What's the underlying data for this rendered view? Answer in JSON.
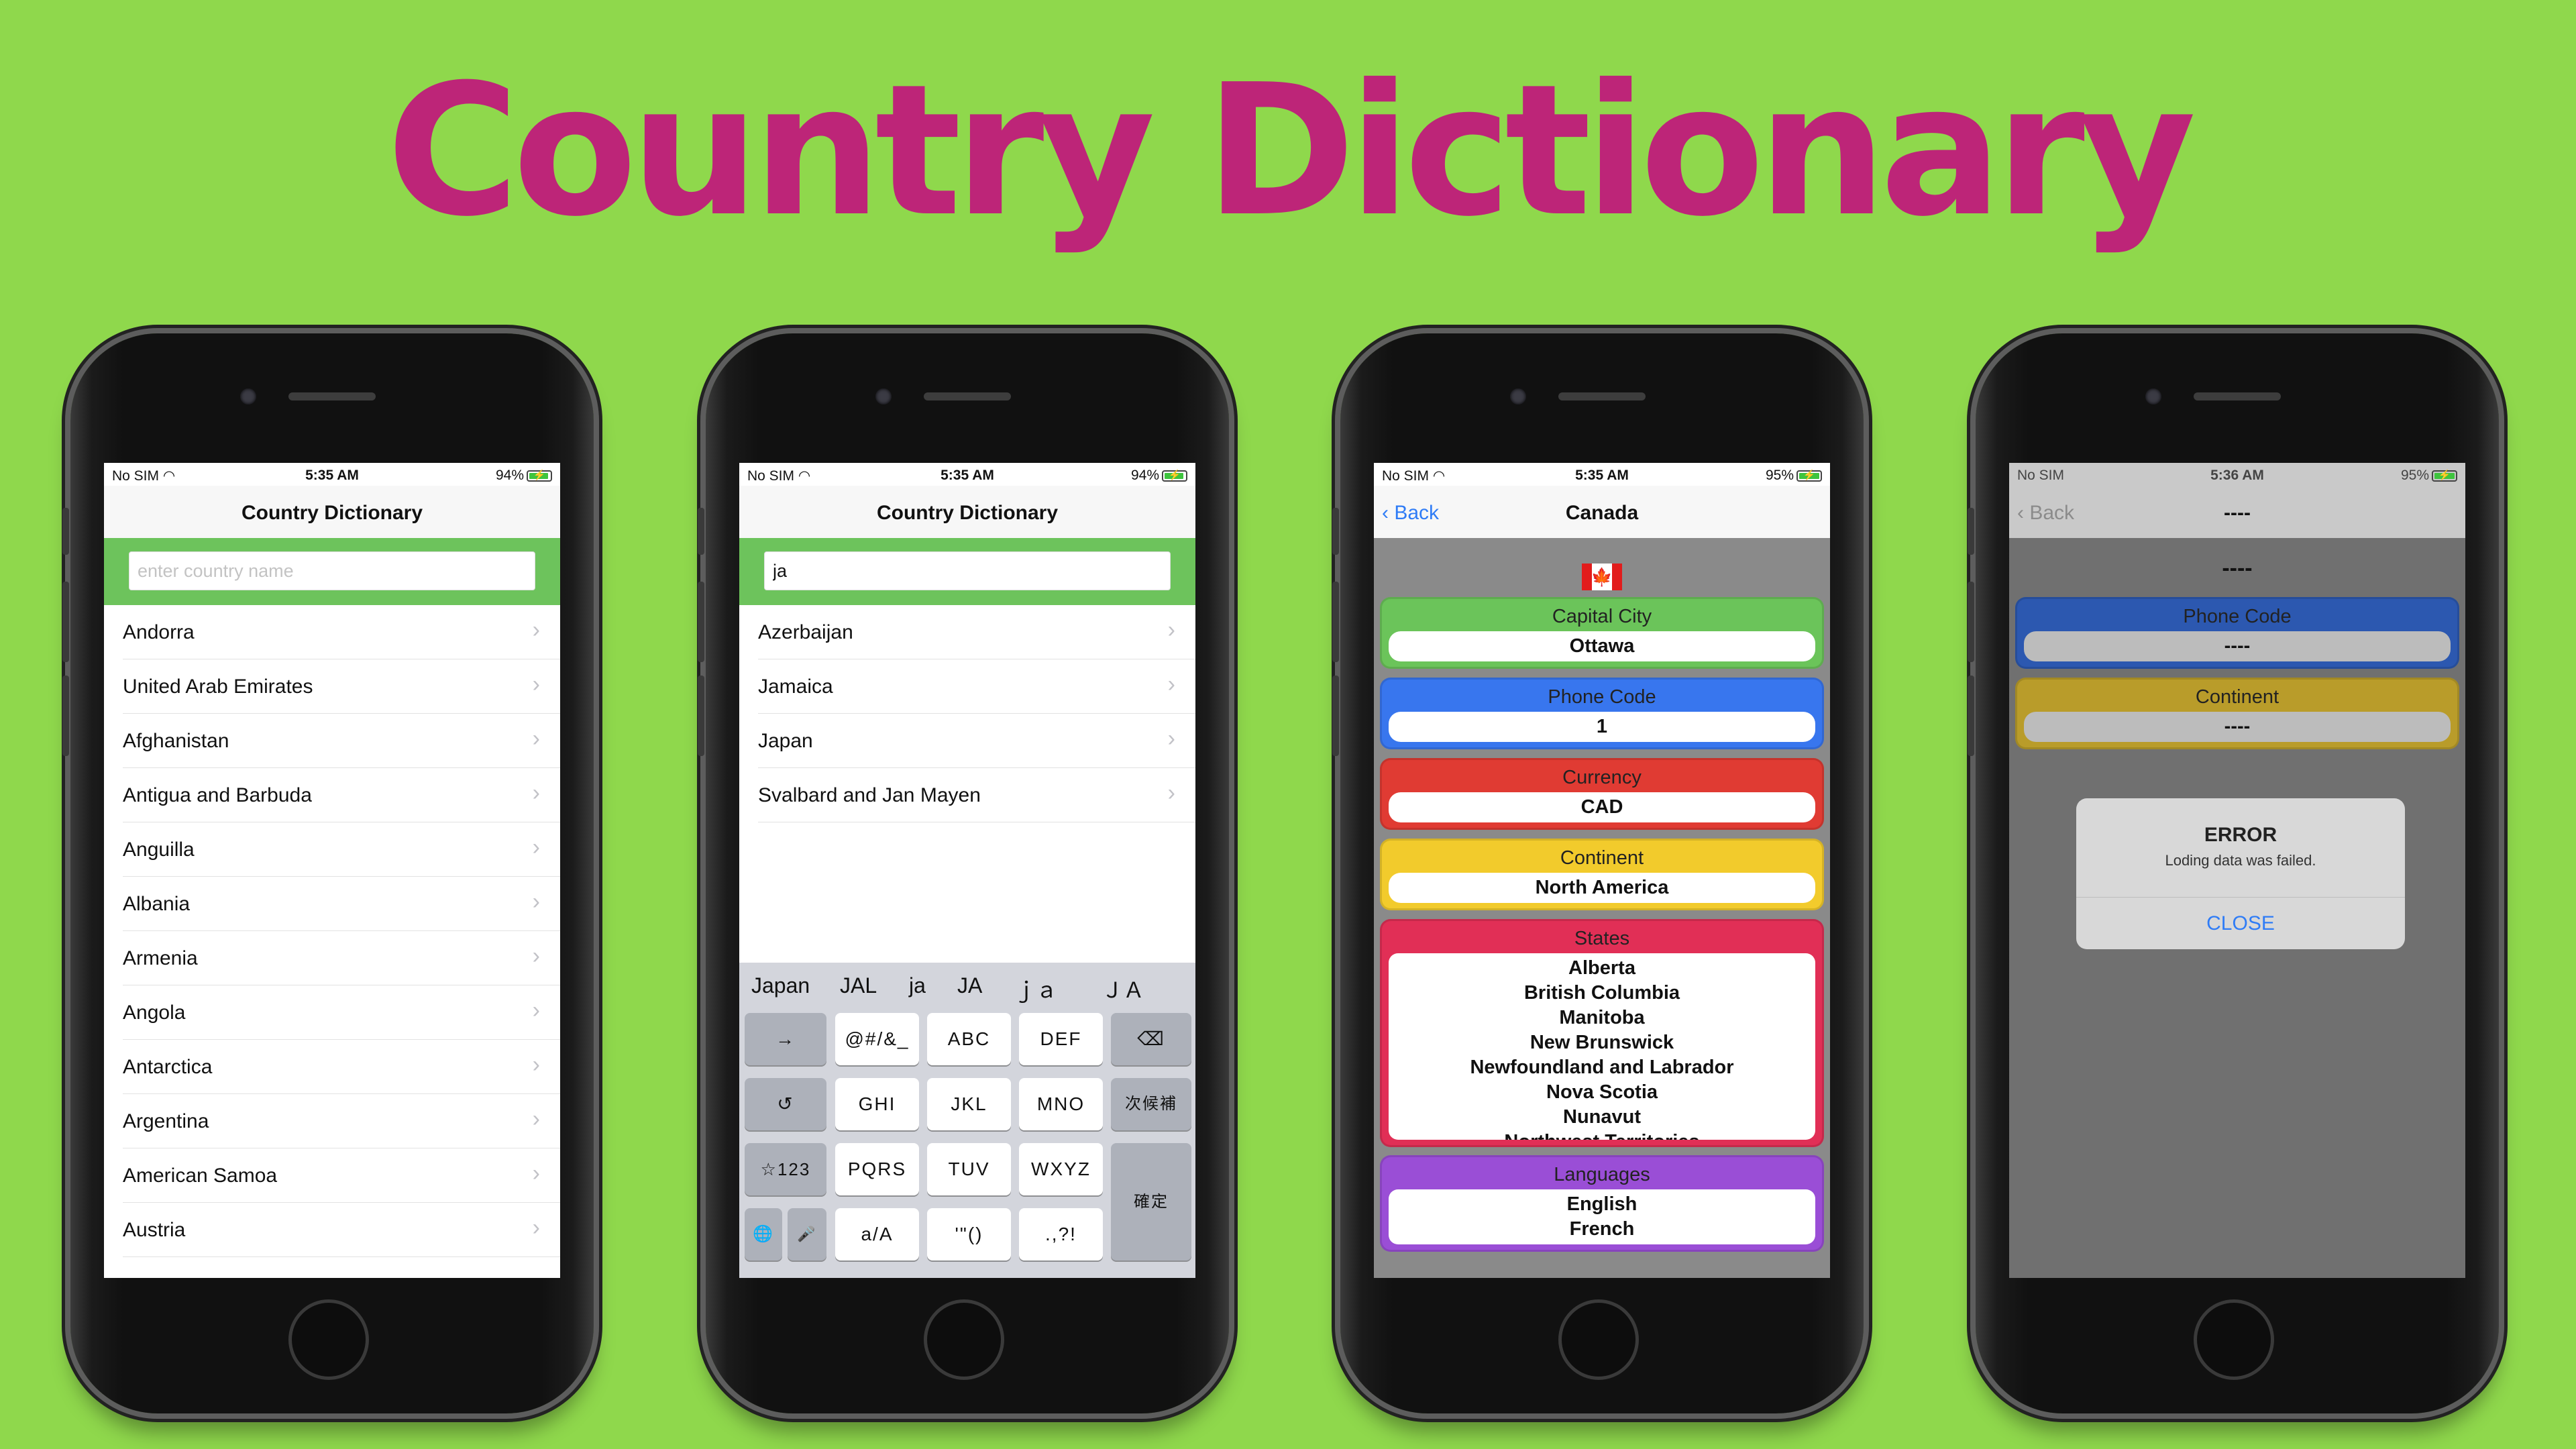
{
  "banner": {
    "title": "Country Dictionary"
  },
  "colors": {
    "background": "#8fd84c",
    "title": "#bd2578",
    "search_bar": "#6dc35c",
    "link_blue": "#2f7cf6",
    "card_capital": "#6bc45a",
    "card_phone": "#3876ee",
    "card_currency": "#e03b33",
    "card_continent": "#f2cb2c",
    "card_states": "#e12f56",
    "card_languages": "#9a4ed6"
  },
  "screen1": {
    "status": {
      "carrier": "No SIM",
      "time": "5:35 AM",
      "battery": "94%"
    },
    "nav_title": "Country Dictionary",
    "search_placeholder": "enter country name",
    "rows": [
      "Andorra",
      "United Arab Emirates",
      "Afghanistan",
      "Antigua and Barbuda",
      "Anguilla",
      "Albania",
      "Armenia",
      "Angola",
      "Antarctica",
      "Argentina",
      "American Samoa",
      "Austria"
    ],
    "chevron": "›"
  },
  "screen2": {
    "status": {
      "carrier": "No SIM",
      "time": "5:35 AM",
      "battery": "94%"
    },
    "nav_title": "Country Dictionary",
    "search_value": "ja",
    "rows": [
      "Azerbaijan",
      "Jamaica",
      "Japan",
      "Svalbard and Jan Mayen"
    ],
    "chevron": "›",
    "keyboard": {
      "suggestions": [
        "Japan",
        "JAL",
        "ja",
        "JA",
        "ｊａ",
        "ＪＡ"
      ],
      "keys": {
        "arrow": "→",
        "symbols": "@#/&_",
        "abc": "ABC",
        "def": "DEF",
        "delete": "⌫",
        "undo": "↺",
        "ghi": "GHI",
        "jkl": "JKL",
        "mno": "MNO",
        "candidates": "次候補",
        "num": "☆123",
        "pqrs": "PQRS",
        "tuv": "TUV",
        "wxyz": "WXYZ",
        "confirm": "確定",
        "globe": "🌐",
        "mic": "🎤",
        "case": "a/A",
        "quotes": "'\"()",
        "punct": ".,?!"
      }
    }
  },
  "screen3": {
    "status": {
      "carrier": "No SIM",
      "time": "5:35 AM",
      "battery": "95%"
    },
    "back": "Back",
    "nav_title": "Canada",
    "flag_leaf": "🍁",
    "capital": {
      "label": "Capital City",
      "value": "Ottawa"
    },
    "phone": {
      "label": "Phone Code",
      "value": "1"
    },
    "currency": {
      "label": "Currency",
      "value": "CAD"
    },
    "continent": {
      "label": "Continent",
      "value": "North America"
    },
    "states": {
      "label": "States",
      "values": [
        "Alberta",
        "British Columbia",
        "Manitoba",
        "New Brunswick",
        "Newfoundland and Labrador",
        "Nova Scotia",
        "Nunavut",
        "Northwest Territories"
      ]
    },
    "languages": {
      "label": "Languages",
      "values": [
        "English",
        "French"
      ]
    }
  },
  "screen4": {
    "status": {
      "carrier": "No SIM",
      "time": "5:36 AM",
      "battery": "95%"
    },
    "back": "Back",
    "nav_title": "----",
    "heading": "----",
    "phone": {
      "label": "Phone Code",
      "value": "----"
    },
    "continent": {
      "label": "Continent",
      "value": "----"
    },
    "alert": {
      "title": "ERROR",
      "message": "Loding data was failed.",
      "button": "CLOSE"
    }
  }
}
